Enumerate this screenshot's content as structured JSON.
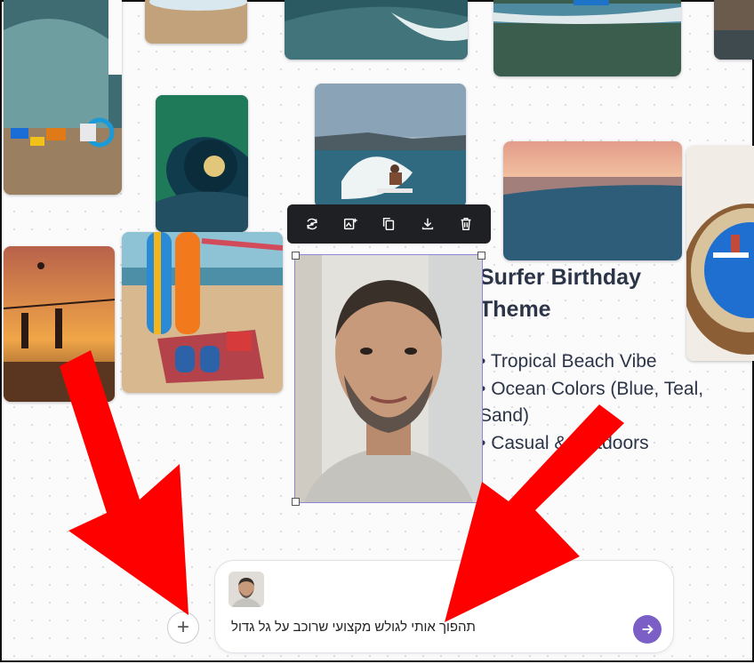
{
  "note": {
    "title": "Surfer Birthday Theme",
    "bullets": [
      "Tropical Beach Vibe",
      "Ocean Colors (Blue, Teal, Sand)",
      "Casual & Outdoors"
    ]
  },
  "toolbar": {
    "icons": [
      "regenerate-icon",
      "edit-image-icon",
      "duplicate-icon",
      "download-icon",
      "delete-icon"
    ]
  },
  "prompt": {
    "text": "תהפוך אותי לגולש מקצועי שרוכב על גל גדול",
    "add_label": "+"
  },
  "colors": {
    "arrow": "#ff0000",
    "send_button": "#7b5fc7",
    "toolbar_bg": "#1f2023",
    "note_text": "#2c3448"
  }
}
